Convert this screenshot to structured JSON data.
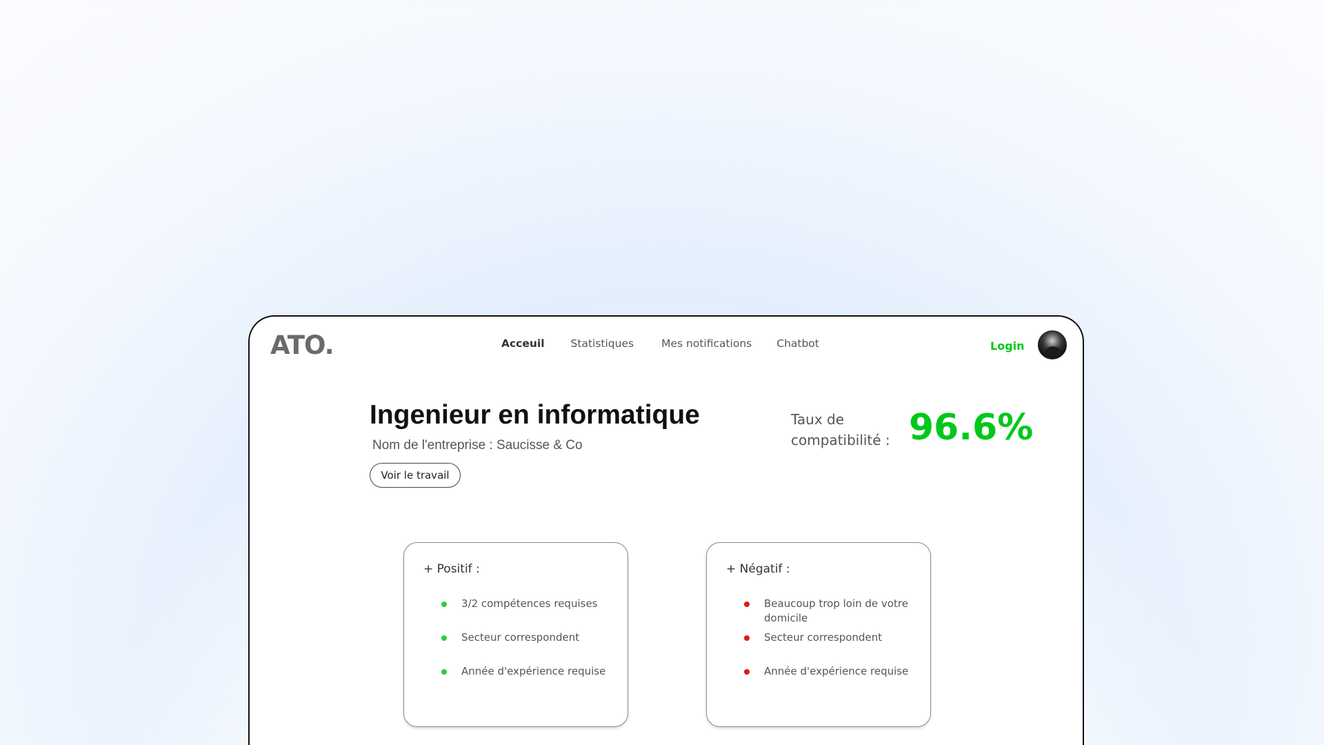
{
  "app": {
    "logo": "ATO."
  },
  "nav": {
    "items": [
      {
        "label": "Acceuil",
        "active": true
      },
      {
        "label": "Statistiques",
        "active": false
      },
      {
        "label": "Mes notifications",
        "active": false
      },
      {
        "label": "Chatbot",
        "active": false
      }
    ],
    "login_label": "Login"
  },
  "job": {
    "title": "Ingenieur en informatique",
    "company": "Nom de l'entreprise : Saucisse & Co",
    "view_button": "Voir le travail"
  },
  "compatibility": {
    "label": "Taux de compatibilité :",
    "value": "96.6%"
  },
  "positive": {
    "title": "+ Positif :",
    "items": [
      "3/2 compétences requises",
      "Secteur correspondent",
      "Année d'expérience requise"
    ]
  },
  "negative": {
    "title": "+ Négatif :",
    "items": [
      "Beaucoup trop loin de votre domicile",
      "Secteur correspondent",
      "Année d'expérience requise"
    ]
  },
  "colors": {
    "accent_green": "#00c81a",
    "positive_dot": "#2ecc40",
    "negative_dot": "#e01616"
  },
  "icons": {
    "avatar": "user-avatar"
  }
}
